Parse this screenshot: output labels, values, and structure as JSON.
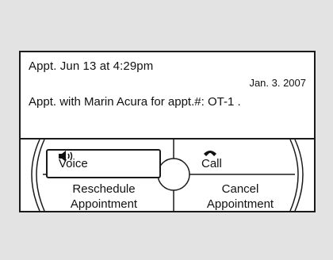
{
  "message": {
    "line1": "Appt. Jun  13 at  4:29pm",
    "date": "Jan. 3. 2007",
    "line2": "Appt. with Marin Acura for appt.#: OT-1 ."
  },
  "buttons": {
    "voice": "Voice",
    "call": "Call",
    "reschedule_line1": "Reschedule",
    "reschedule_line2": "Appointment",
    "cancel_line1": "Cancel",
    "cancel_line2": "Appointment"
  },
  "icons": {
    "voice": "speaker-icon",
    "call": "phone-icon",
    "center": "knob-icon"
  },
  "colors": {
    "background": "#e3e3e3",
    "screen": "#ffffff",
    "border": "#1a1a1a"
  }
}
